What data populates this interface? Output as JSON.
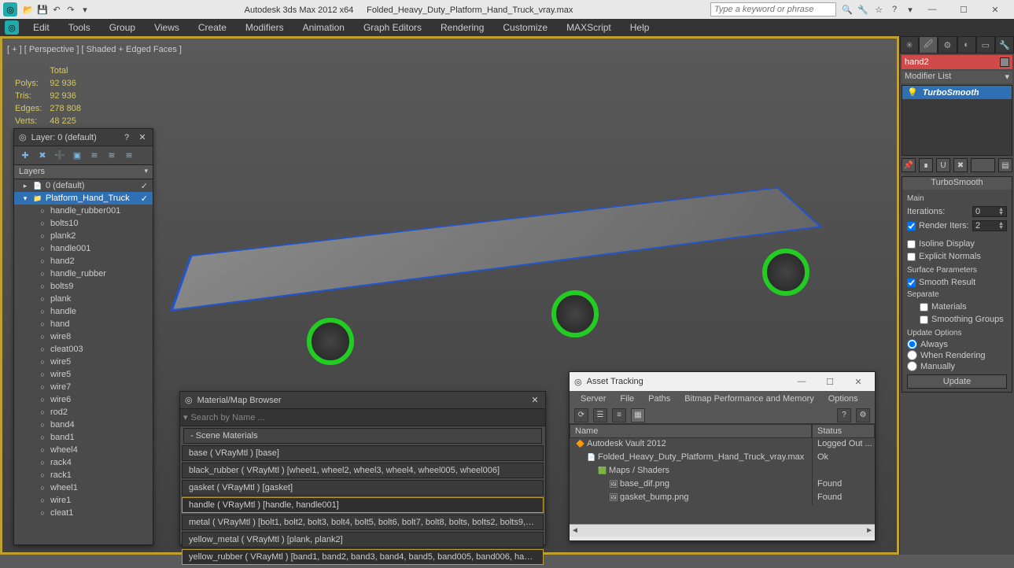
{
  "titlebar": {
    "app": "Autodesk 3ds Max  2012 x64",
    "file": "Folded_Heavy_Duty_Platform_Hand_Truck_vray.max",
    "search_placeholder": "Type a keyword or phrase"
  },
  "menus": [
    "Edit",
    "Tools",
    "Group",
    "Views",
    "Create",
    "Modifiers",
    "Animation",
    "Graph Editors",
    "Rendering",
    "Customize",
    "MAXScript",
    "Help"
  ],
  "viewport": {
    "label": "[ + ]  [ Perspective ]  [ Shaded + Edged Faces ]",
    "stats_header": "Total",
    "stats": [
      [
        "Polys:",
        "92 936"
      ],
      [
        "Tris:",
        "92 936"
      ],
      [
        "Edges:",
        "278 808"
      ],
      [
        "Verts:",
        "48 225"
      ]
    ]
  },
  "layers_panel": {
    "title": "Layer: 0 (default)",
    "header_col": "Layers",
    "items": [
      {
        "depth": 0,
        "icon": "📄",
        "label": "0 (default)",
        "check": true
      },
      {
        "depth": 0,
        "icon": "📁",
        "label": "Platform_Hand_Truck",
        "sel": true,
        "check": true
      },
      {
        "depth": 1,
        "icon": "○",
        "label": "handle_rubber001"
      },
      {
        "depth": 1,
        "icon": "○",
        "label": "bolts10"
      },
      {
        "depth": 1,
        "icon": "○",
        "label": "plank2"
      },
      {
        "depth": 1,
        "icon": "○",
        "label": "handle001"
      },
      {
        "depth": 1,
        "icon": "○",
        "label": "hand2"
      },
      {
        "depth": 1,
        "icon": "○",
        "label": "handle_rubber"
      },
      {
        "depth": 1,
        "icon": "○",
        "label": "bolts9"
      },
      {
        "depth": 1,
        "icon": "○",
        "label": "plank"
      },
      {
        "depth": 1,
        "icon": "○",
        "label": "handle"
      },
      {
        "depth": 1,
        "icon": "○",
        "label": "hand"
      },
      {
        "depth": 1,
        "icon": "○",
        "label": "wire8"
      },
      {
        "depth": 1,
        "icon": "○",
        "label": "cleat003"
      },
      {
        "depth": 1,
        "icon": "○",
        "label": "wire5"
      },
      {
        "depth": 1,
        "icon": "○",
        "label": "wire5"
      },
      {
        "depth": 1,
        "icon": "○",
        "label": "wire7"
      },
      {
        "depth": 1,
        "icon": "○",
        "label": "wire6"
      },
      {
        "depth": 1,
        "icon": "○",
        "label": "rod2"
      },
      {
        "depth": 1,
        "icon": "○",
        "label": "band4"
      },
      {
        "depth": 1,
        "icon": "○",
        "label": "band1"
      },
      {
        "depth": 1,
        "icon": "○",
        "label": "wheel4"
      },
      {
        "depth": 1,
        "icon": "○",
        "label": "rack4"
      },
      {
        "depth": 1,
        "icon": "○",
        "label": "rack1"
      },
      {
        "depth": 1,
        "icon": "○",
        "label": "wheel1"
      },
      {
        "depth": 1,
        "icon": "○",
        "label": "wire1"
      },
      {
        "depth": 1,
        "icon": "○",
        "label": "cleat1"
      }
    ]
  },
  "mat_panel": {
    "title": "Material/Map Browser",
    "search": "Search by Name ...",
    "section": "- Scene Materials",
    "items": [
      {
        "label": "base  ( VRayMtl )  [base]"
      },
      {
        "label": "black_rubber  ( VRayMtl )  [wheel1, wheel2, wheel3, wheel4, wheel005, wheel006]"
      },
      {
        "label": "gasket  ( VRayMtl )  [gasket]"
      },
      {
        "label": "handle  ( VRayMtl )  [handle, handle001]",
        "sel": true
      },
      {
        "label": "metal  ( VRayMtl )  [bolt1, bolt2, bolt3, bolt4, bolt5, bolt6, bolt7, bolt8, bolts, bolts2, bolts9, bolts…"
      },
      {
        "label": "yellow_metal  ( VRayMtl )  [plank, plank2]"
      },
      {
        "label": "yellow_rubber  ( VRayMtl )  [band1, band2, band3, band4, band5, band005, band006, handle_rub…",
        "sel": true
      }
    ]
  },
  "asset_panel": {
    "title": "Asset Tracking",
    "menus": [
      "Server",
      "File",
      "Paths",
      "Bitmap Performance and Memory",
      "Options"
    ],
    "cols": [
      "Name",
      "Status"
    ],
    "rows": [
      {
        "indent": 0,
        "icon": "🔶",
        "name": "Autodesk Vault 2012",
        "status": "Logged Out ..."
      },
      {
        "indent": 1,
        "icon": "📄",
        "name": "Folded_Heavy_Duty_Platform_Hand_Truck_vray.max",
        "status": "Ok"
      },
      {
        "indent": 2,
        "icon": "🟩",
        "name": "Maps / Shaders",
        "status": ""
      },
      {
        "indent": 3,
        "icon": "🖼",
        "name": "base_dif.png",
        "status": "Found"
      },
      {
        "indent": 3,
        "icon": "🖼",
        "name": "gasket_bump.png",
        "status": "Found"
      }
    ]
  },
  "cmd_panel": {
    "obj_name": "hand2",
    "mod_list_label": "Modifier List",
    "modifier": "TurboSmooth",
    "rollout_title": "TurboSmooth",
    "main_label": "Main",
    "iterations_label": "Iterations:",
    "iterations_val": "0",
    "render_iters_label": "Render Iters:",
    "render_iters_val": "2",
    "isoline_label": "Isoline Display",
    "explicit_label": "Explicit Normals",
    "surface_label": "Surface Parameters",
    "smooth_result_label": "Smooth Result",
    "separate_label": "Separate",
    "sep_materials": "Materials",
    "sep_smoothing": "Smoothing Groups",
    "update_label": "Update Options",
    "update_always": "Always",
    "update_render": "When Rendering",
    "update_manual": "Manually",
    "update_btn": "Update"
  }
}
